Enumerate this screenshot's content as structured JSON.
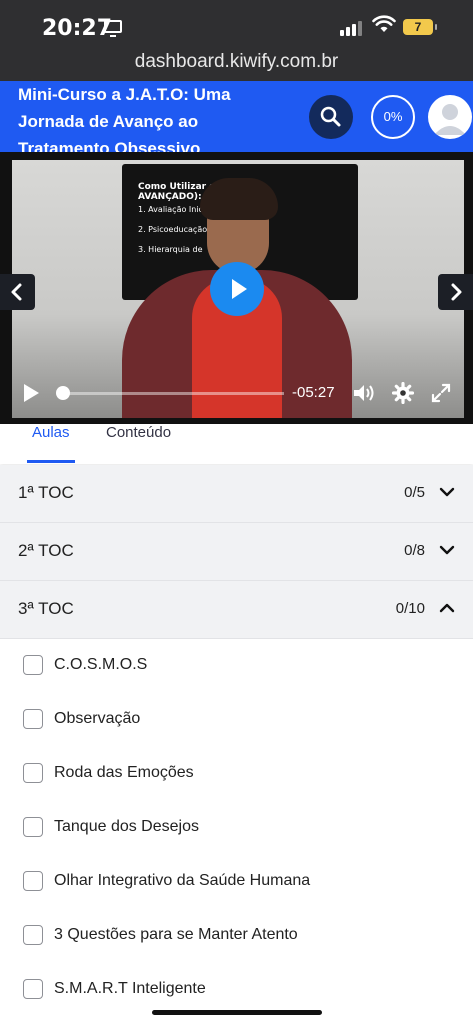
{
  "status_bar": {
    "time": "20:27",
    "battery": "7"
  },
  "browser": {
    "url": "dashboard.kiwify.com.br"
  },
  "header": {
    "title": "Mini-Curso a J.A.T.O: Uma Jornada de Avanço ao Tratamento Obsessivo",
    "progress": "0%"
  },
  "player": {
    "time_remaining": "-05:27",
    "progress": 0.0,
    "slide_text": [
      "Como Utilizar o",
      "AVANÇADO):",
      "1. Avaliação Inicial:",
      "2. Psicoeducação:",
      "3. Hierarquia de"
    ]
  },
  "tabs": [
    {
      "label": "Aulas",
      "active": true
    },
    {
      "label": "Conteúdo",
      "active": false
    }
  ],
  "modules": [
    {
      "title": "1ª TOC",
      "count": "0/5",
      "expanded": false
    },
    {
      "title": "2ª TOC",
      "count": "0/8",
      "expanded": false
    },
    {
      "title": "3ª TOC",
      "count": "0/10",
      "expanded": true
    }
  ],
  "lessons": [
    {
      "title": "C.O.S.M.O.S"
    },
    {
      "title": "Observação"
    },
    {
      "title": "Roda das Emoções"
    },
    {
      "title": "Tanque dos Desejos"
    },
    {
      "title": "Olhar Integrativo da Saúde Humana"
    },
    {
      "title": "3 Questões para se Manter Atento"
    },
    {
      "title": "S.M.A.R.T Inteligente"
    }
  ],
  "colors": {
    "brand": "#1f5af2",
    "play_button": "#1b8af0",
    "search_button": "#132a5c"
  }
}
